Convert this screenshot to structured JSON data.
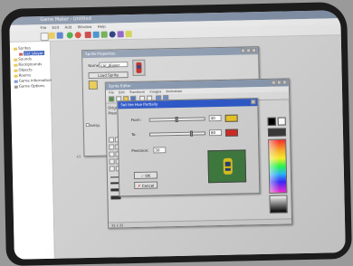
{
  "app": {
    "title": "Game Maker - Untitled",
    "menu": [
      "File",
      "Edit",
      "Add",
      "Window",
      "Help"
    ]
  },
  "resource_tree": {
    "items": [
      {
        "label": "Sprites",
        "icon": "folder-icon"
      },
      {
        "label": "car_player",
        "icon": "sprite-icon",
        "selected": true
      },
      {
        "label": "Sounds",
        "icon": "folder-icon"
      },
      {
        "label": "Backgrounds",
        "icon": "folder-icon"
      },
      {
        "label": "Objects",
        "icon": "folder-icon"
      },
      {
        "label": "Rooms",
        "icon": "folder-icon"
      },
      {
        "label": "Game Information",
        "icon": "info-icon"
      },
      {
        "label": "Game Options",
        "icon": "gear-icon"
      }
    ]
  },
  "workspace": {
    "side_mark": "x1"
  },
  "sprite_properties": {
    "title": "Sprite Properties",
    "name_label": "Name:",
    "name_value": "car_player",
    "load_button": "Load Sprite",
    "transparent_label": "Transp."
  },
  "sprite_editor": {
    "title": "Sprite Editor",
    "menu": [
      "File",
      "Edit",
      "Transform",
      "Images",
      "Animation"
    ],
    "origin_label": "Origin",
    "preview_label": "Preview",
    "status": "32 x 32"
  },
  "dialog": {
    "title": "Set the Hue Partially",
    "from_label": "From:",
    "to_label": "To:",
    "from_value": "40",
    "to_value": "80",
    "from_color": "#e6c32a",
    "to_color": "#d02a22",
    "precision_label": "Precision:",
    "precision_value": "30",
    "ok_label": "OK",
    "cancel_label": "Cancel"
  }
}
